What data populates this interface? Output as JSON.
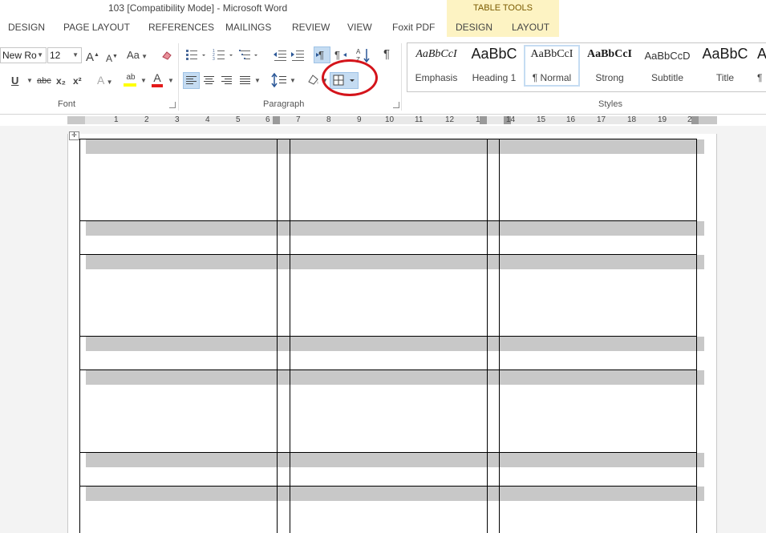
{
  "window": {
    "title": "103 [Compatibility Mode] - Microsoft Word"
  },
  "context_tab_group": "TABLE TOOLS",
  "tabs": [
    "DESIGN",
    "PAGE LAYOUT",
    "REFERENCES",
    "MAILINGS",
    "REVIEW",
    "VIEW",
    "Foxit PDF",
    "DESIGN",
    "LAYOUT"
  ],
  "font": {
    "name": "New Ro",
    "size": "12",
    "grow_label": "A",
    "shrink_label": "A",
    "change_case_label": "Aa",
    "underline_label": "U",
    "strike_label": "abc",
    "subscript_label": "x₂",
    "superscript_label": "x²",
    "text_effects_label": "A",
    "highlight_label": "ab",
    "font_color_label": "A",
    "group_label": "Font"
  },
  "paragraph": {
    "group_label": "Paragraph",
    "pilcrow_label": "¶"
  },
  "styles": {
    "group_label": "Styles",
    "items": [
      {
        "preview": "AaBbCcI",
        "name": "Emphasis"
      },
      {
        "preview": "AaBbC",
        "name": "Heading 1"
      },
      {
        "preview": "AaBbCcI",
        "name": "¶ Normal"
      },
      {
        "preview": "AaBbCcI",
        "name": "Strong"
      },
      {
        "preview": "AaBbCcD",
        "name": "Subtitle"
      },
      {
        "preview": "AaBbC",
        "name": "Title"
      },
      {
        "preview": "A",
        "name": "¶"
      }
    ]
  },
  "ruler": {
    "numbers": [
      "1",
      "2",
      "3",
      "4",
      "5",
      "6",
      "7",
      "8",
      "9",
      "10",
      "11",
      "12",
      "1",
      "14",
      "15",
      "16",
      "17",
      "18",
      "19",
      "2"
    ]
  },
  "colors": {
    "annotation": "#d4141b",
    "highlight": "#ffff00",
    "font_color": "#e41b1b",
    "selected": "#c5dcf2"
  }
}
